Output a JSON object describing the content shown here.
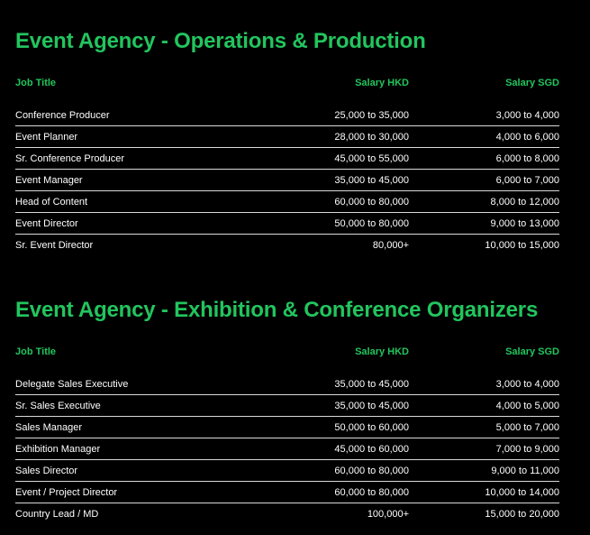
{
  "colors": {
    "accent": "#22c55e",
    "background": "#000000",
    "text": "#ffffff",
    "divider": "#d9d9d9"
  },
  "sections": [
    {
      "title": "Event Agency - Operations & Production",
      "headers": {
        "title": "Job Title",
        "hkd": "Salary HKD",
        "sgd": "Salary SGD"
      },
      "rows": [
        {
          "title": "Conference Producer",
          "hkd": "25,000 to 35,000",
          "sgd": "3,000 to 4,000"
        },
        {
          "title": "Event Planner",
          "hkd": "28,000 to 30,000",
          "sgd": "4,000 to 6,000"
        },
        {
          "title": "Sr. Conference Producer",
          "hkd": "45,000 to 55,000",
          "sgd": "6,000 to 8,000"
        },
        {
          "title": "Event Manager",
          "hkd": "35,000 to 45,000",
          "sgd": "6,000 to 7,000"
        },
        {
          "title": "Head of Content",
          "hkd": "60,000 to 80,000",
          "sgd": "8,000 to 12,000"
        },
        {
          "title": "Event Director",
          "hkd": "50,000 to 80,000",
          "sgd": "9,000 to 13,000"
        },
        {
          "title": "Sr. Event Director",
          "hkd": "80,000+",
          "sgd": "10,000 to 15,000"
        }
      ]
    },
    {
      "title": "Event Agency - Exhibition & Conference Organizers",
      "headers": {
        "title": "Job Title",
        "hkd": "Salary HKD",
        "sgd": "Salary SGD"
      },
      "rows": [
        {
          "title": "Delegate Sales Executive",
          "hkd": "35,000 to 45,000",
          "sgd": "3,000 to 4,000"
        },
        {
          "title": "Sr. Sales Executive",
          "hkd": "35,000 to 45,000",
          "sgd": "4,000 to 5,000"
        },
        {
          "title": "Sales Manager",
          "hkd": "50,000 to 60,000",
          "sgd": "5,000 to 7,000"
        },
        {
          "title": "Exhibition Manager",
          "hkd": "45,000 to 60,000",
          "sgd": "7,000 to 9,000"
        },
        {
          "title": "Sales Director",
          "hkd": "60,000 to 80,000",
          "sgd": "9,000 to 11,000"
        },
        {
          "title": "Event / Project Director",
          "hkd": "60,000 to 80,000",
          "sgd": "10,000 to 14,000"
        },
        {
          "title": "Country Lead / MD",
          "hkd": "100,000+",
          "sgd": "15,000 to 20,000"
        }
      ]
    }
  ]
}
